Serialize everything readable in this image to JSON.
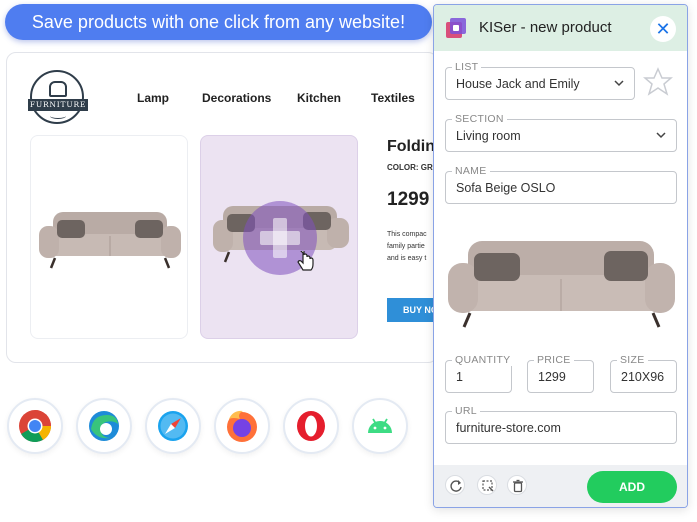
{
  "banner": {
    "text": "Save products with one click from any website!"
  },
  "site": {
    "logo_text": "FURNITURE",
    "nav": [
      "Lamp",
      "Decorations",
      "Kitchen",
      "Textiles"
    ],
    "product": {
      "title": "Folding",
      "color_label": "COLOR: GR",
      "price": "1299",
      "description_lines": [
        "This compac",
        "family partie",
        "and is easy t"
      ],
      "buy_label": "BUY NO"
    }
  },
  "browsers": [
    "chrome-icon",
    "edge-icon",
    "safari-icon",
    "firefox-icon",
    "opera-icon",
    "android-icon"
  ],
  "popup": {
    "title": "KISer - new product",
    "close_symbol": "✕",
    "list": {
      "label": "LIST",
      "value": "House Jack and Emily"
    },
    "section": {
      "label": "SECTION",
      "value": "Living room"
    },
    "name": {
      "label": "NAME",
      "value": "Sofa Beige OSLO"
    },
    "quantity": {
      "label": "QUANTITY",
      "value": "1"
    },
    "price": {
      "label": "PRICE",
      "value": "1299"
    },
    "size": {
      "label": "SIZE",
      "value": "210X96"
    },
    "url": {
      "label": "URL",
      "value": "furniture-store.com"
    },
    "add_label": "ADD"
  },
  "colors": {
    "accent_blue": "#4f7df0",
    "add_green": "#22cc5e",
    "header_green": "#ddefe4",
    "hover_purple": "#ece3f2"
  }
}
